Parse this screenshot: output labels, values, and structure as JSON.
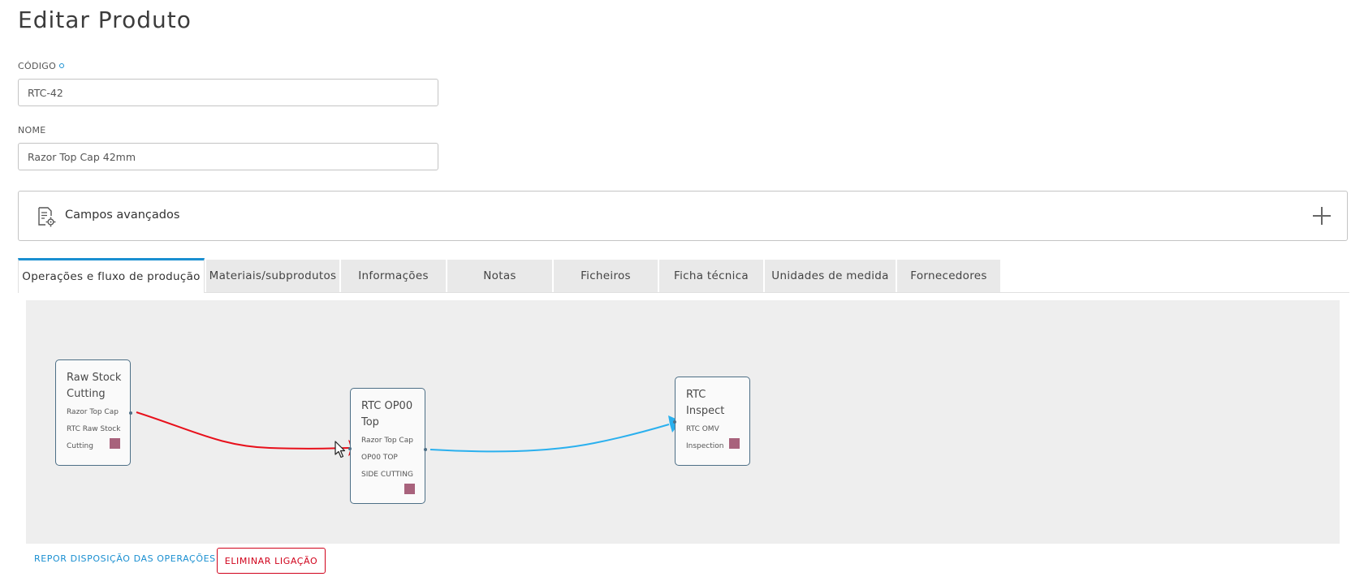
{
  "page": {
    "title": "Editar Produto"
  },
  "form": {
    "code": {
      "label": "CÓDIGO",
      "value": "RTC-42"
    },
    "name": {
      "label": "NOME",
      "value": "Razor Top Cap 42mm"
    }
  },
  "advanced": {
    "label": "Campos avançados"
  },
  "tabs": [
    {
      "label": "Operações e fluxo de produção",
      "active": true
    },
    {
      "label": "Materiais/subprodutos"
    },
    {
      "label": "Informações"
    },
    {
      "label": "Notas"
    },
    {
      "label": "Ficheiros"
    },
    {
      "label": "Ficha técnica"
    },
    {
      "label": "Unidades de medida"
    },
    {
      "label": "Fornecedores"
    }
  ],
  "flow": {
    "nodes": [
      {
        "title_lines": [
          "Raw Stock",
          "Cutting"
        ],
        "lines": [
          "Razor Top Cap",
          "RTC Raw Stock",
          "Cutting"
        ]
      },
      {
        "title_lines": [
          "RTC OP00",
          "Top"
        ],
        "lines": [
          "Razor Top Cap",
          "OP00 TOP",
          "SIDE CUTTING"
        ]
      },
      {
        "title_lines": [
          "RTC",
          "Inspect"
        ],
        "lines": [
          "RTC OMV",
          "Inspection"
        ]
      }
    ],
    "links": [
      {
        "from": 0,
        "to": 1,
        "status": "selected",
        "color": "#e8101b"
      },
      {
        "from": 1,
        "to": 2,
        "status": "normal",
        "color": "#2ab0ee"
      }
    ],
    "swatch_color": "#a8627c"
  },
  "actions": {
    "reset_layout": "REPOR DISPOSIÇÃO DAS OPERAÇÕES",
    "delete_link": "ELIMINAR LIGAÇÃO"
  }
}
